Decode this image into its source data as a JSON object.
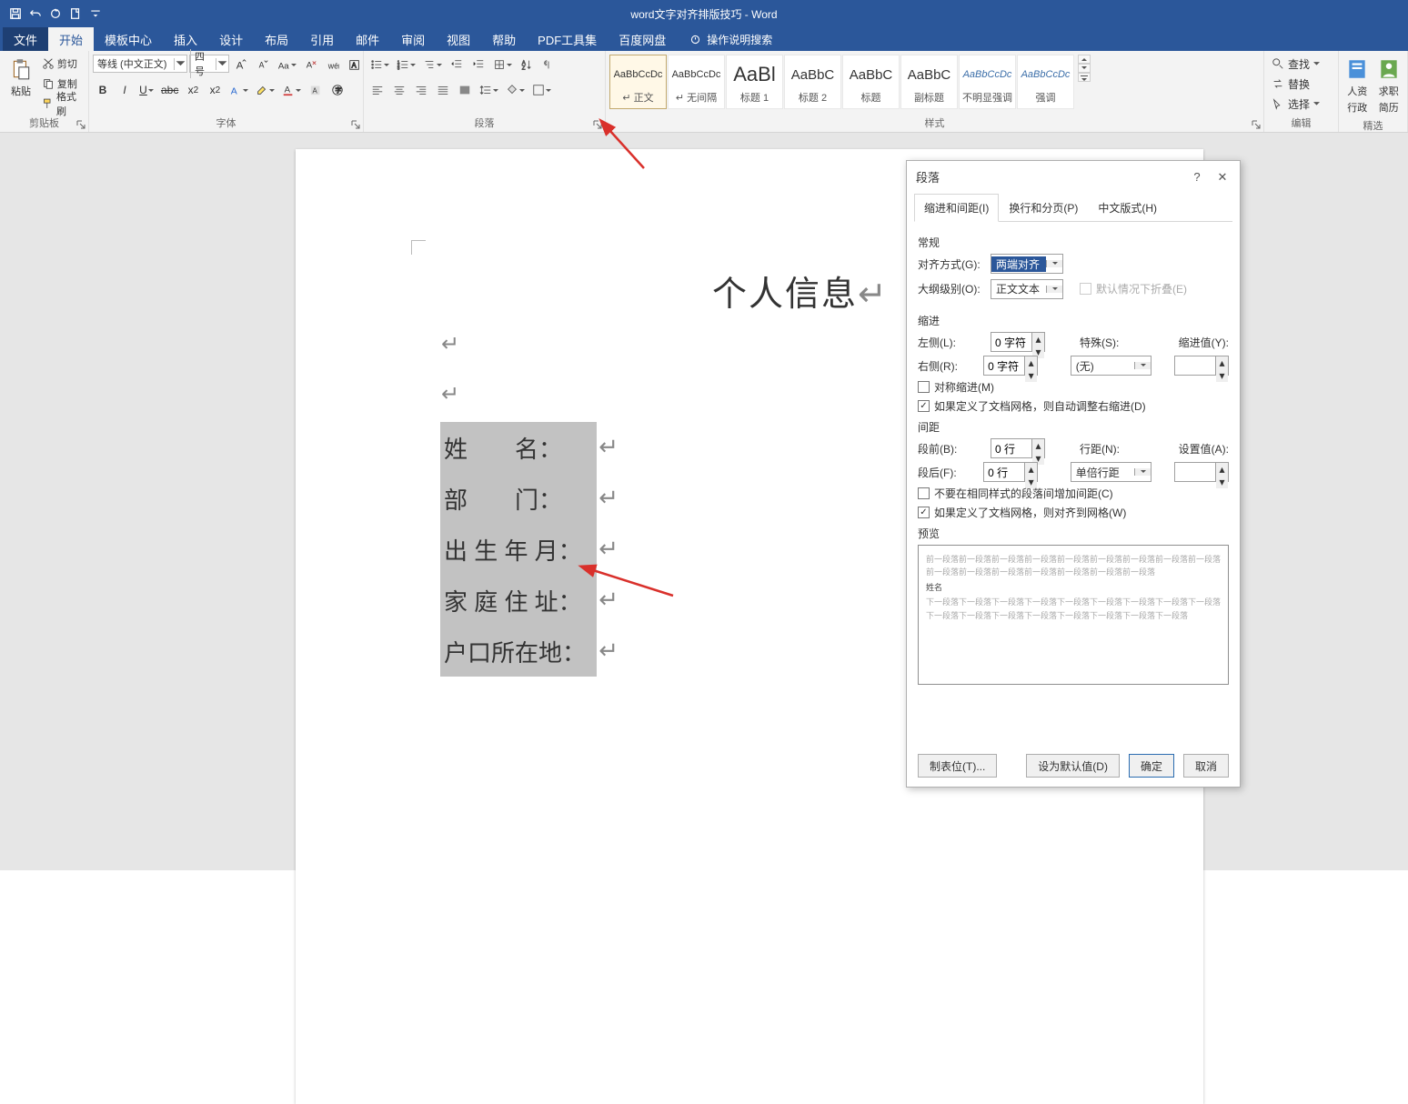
{
  "window": {
    "title": "word文字对齐排版技巧 - Word"
  },
  "qat": {
    "save": "保存",
    "undo": "撤销",
    "redo": "重做",
    "touch": "自定义"
  },
  "tabs": {
    "file": "文件",
    "home": "开始",
    "template": "模板中心",
    "insert": "插入",
    "design": "设计",
    "layout": "布局",
    "references": "引用",
    "mail": "邮件",
    "review": "审阅",
    "view": "视图",
    "help": "帮助",
    "pdf": "PDF工具集",
    "baidu": "百度网盘",
    "tellme": "操作说明搜索"
  },
  "ribbon": {
    "clipboard": {
      "label": "剪贴板",
      "paste": "粘贴",
      "cut": "剪切",
      "copy": "复制",
      "format_painter": "格式刷"
    },
    "font": {
      "label": "字体",
      "name": "等线 (中文正文)",
      "size": "四号"
    },
    "paragraph": {
      "label": "段落"
    },
    "styles": {
      "label": "样式",
      "items": [
        {
          "prev": "AaBbCcDc",
          "lbl": "↵ 正文"
        },
        {
          "prev": "AaBbCcDc",
          "lbl": "↵ 无间隔"
        },
        {
          "prev": "AaBl",
          "lbl": "标题 1",
          "big": true
        },
        {
          "prev": "AaBbC",
          "lbl": "标题 2"
        },
        {
          "prev": "AaBbC",
          "lbl": "标题"
        },
        {
          "prev": "AaBbC",
          "lbl": "副标题"
        },
        {
          "prev": "AaBbCcDc",
          "lbl": "不明显强调",
          "italic": true
        },
        {
          "prev": "AaBbCcDc",
          "lbl": "强调",
          "italic": true
        }
      ]
    },
    "editing": {
      "label": "编辑",
      "find": "查找",
      "replace": "替换",
      "select": "选择"
    },
    "addin1": {
      "top": "人资",
      "bottom": "行政"
    },
    "addin2": {
      "top": "求职",
      "bottom": "简历"
    },
    "addin_group": "精选"
  },
  "document": {
    "title": "个人信息",
    "lines": [
      "姓　　名：",
      "部　　门：",
      "出 生 年 月：",
      "家 庭 住 址：",
      "户口所在地："
    ]
  },
  "dialog": {
    "title": "段落",
    "tabs": {
      "indent": "缩进和间距(I)",
      "linebreak": "换行和分页(P)",
      "cjk": "中文版式(H)"
    },
    "general": "常规",
    "alignment_label": "对齐方式(G):",
    "alignment_value": "两端对齐",
    "outline_label": "大纲级别(O):",
    "outline_value": "正文文本",
    "collapse": "默认情况下折叠(E)",
    "indent": "缩进",
    "left_label": "左侧(L):",
    "left_value": "0 字符",
    "right_label": "右侧(R):",
    "right_value": "0 字符",
    "special_label": "特殊(S):",
    "special_value": "(无)",
    "indent_by_label": "缩进值(Y):",
    "mirror": "对称缩进(M)",
    "adjust_right": "如果定义了文档网格，则自动调整右缩进(D)",
    "spacing": "间距",
    "before_label": "段前(B):",
    "before_value": "0 行",
    "after_label": "段后(F):",
    "after_value": "0 行",
    "line_spacing_label": "行距(N):",
    "line_spacing_value": "单倍行距",
    "at_label": "设置值(A):",
    "dont_add": "不要在相同样式的段落间增加间距(C)",
    "snap_grid": "如果定义了文档网格，则对齐到网格(W)",
    "preview": "预览",
    "preview_sample": "姓名",
    "tabs_btn": "制表位(T)...",
    "default_btn": "设为默认值(D)",
    "ok": "确定",
    "cancel": "取消"
  }
}
